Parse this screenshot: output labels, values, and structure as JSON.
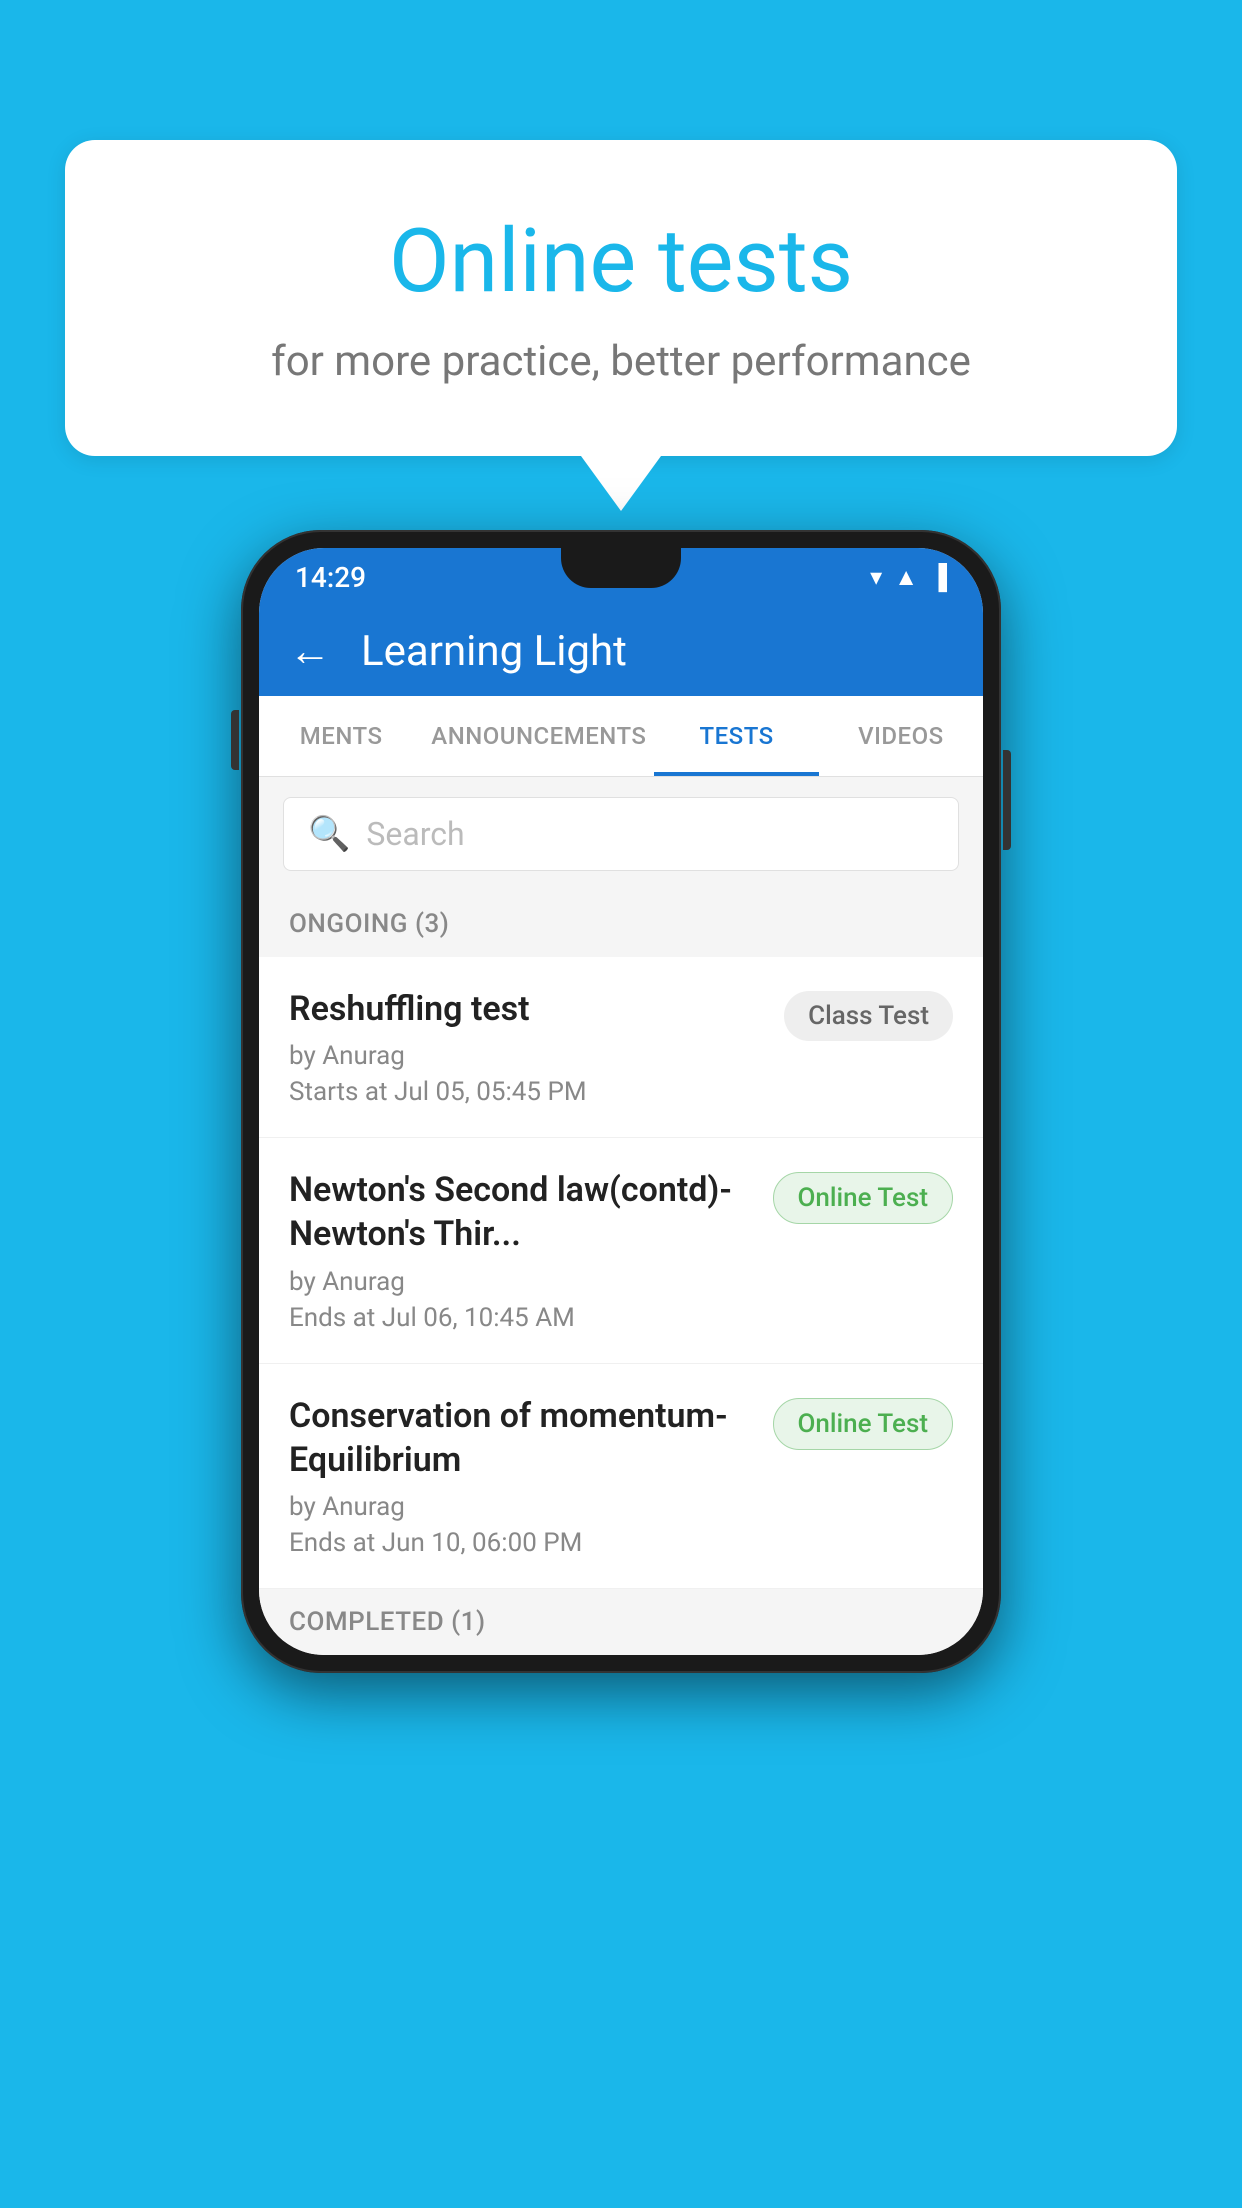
{
  "background": {
    "color": "#1ab7ea"
  },
  "speech_bubble": {
    "title": "Online tests",
    "subtitle": "for more practice, better performance"
  },
  "status_bar": {
    "time": "14:29",
    "wifi_icon": "▼",
    "signal_icon": "▲",
    "battery_icon": "▐"
  },
  "app_bar": {
    "title": "Learning Light",
    "back_label": "←"
  },
  "tabs": [
    {
      "label": "MENTS",
      "active": false
    },
    {
      "label": "ANNOUNCEMENTS",
      "active": false
    },
    {
      "label": "TESTS",
      "active": true
    },
    {
      "label": "VIDEOS",
      "active": false
    }
  ],
  "search": {
    "placeholder": "Search"
  },
  "ongoing_section": {
    "label": "ONGOING (3)"
  },
  "tests": [
    {
      "name": "Reshuffling test",
      "author": "by Anurag",
      "time_label": "Starts at",
      "time": "Jul 05, 05:45 PM",
      "badge": "Class Test",
      "badge_type": "class"
    },
    {
      "name": "Newton's Second law(contd)-Newton's Thir...",
      "author": "by Anurag",
      "time_label": "Ends at",
      "time": "Jul 06, 10:45 AM",
      "badge": "Online Test",
      "badge_type": "online"
    },
    {
      "name": "Conservation of momentum-Equilibrium",
      "author": "by Anurag",
      "time_label": "Ends at",
      "time": "Jun 10, 06:00 PM",
      "badge": "Online Test",
      "badge_type": "online"
    }
  ],
  "completed_section": {
    "label": "COMPLETED (1)"
  }
}
